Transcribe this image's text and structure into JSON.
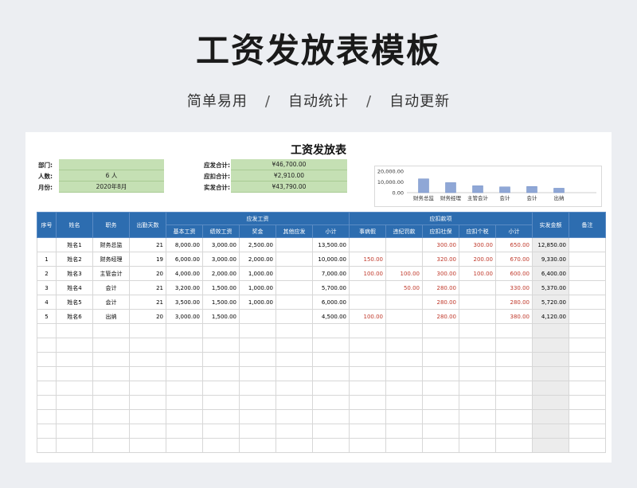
{
  "hero": {
    "title": "工资发放表模板",
    "subtitle_parts": [
      "简单易用",
      "/",
      "自动统计",
      "/",
      "自动更新"
    ]
  },
  "sheet": {
    "title": "工资发放表",
    "left_info": [
      {
        "label": "部门:",
        "value": ""
      },
      {
        "label": "人数:",
        "value": "6 人"
      },
      {
        "label": "月份:",
        "value": "2020年8月"
      }
    ],
    "totals_info": [
      {
        "label": "应发合计:",
        "value": "¥46,700.00"
      },
      {
        "label": "应扣合计:",
        "value": "¥2,910.00"
      },
      {
        "label": "实发合计:",
        "value": "¥43,790.00"
      }
    ]
  },
  "chart_data": {
    "type": "bar",
    "categories": [
      "财务总监",
      "财务经理",
      "主管会计",
      "会计",
      "会计",
      "出纳"
    ],
    "values": [
      12850,
      9330,
      6400,
      5370,
      5720,
      4120
    ],
    "tick_labels": [
      "20,000.00",
      "10,000.00",
      "0.00"
    ],
    "ylim": [
      0,
      20000
    ],
    "bar_color": "#8fa7d6",
    "grid": false
  },
  "table": {
    "header_top": {
      "seq": "序号",
      "name": "姓名",
      "position": "职务",
      "days": "出勤天数",
      "payable_group": "应发工资",
      "deduct_group": "应扣款项",
      "net": "实发金额",
      "note": "备注"
    },
    "header_sub": {
      "base": "基本工资",
      "perf": "绩效工资",
      "bonus": "奖金",
      "other": "其他应发",
      "sub1": "小计",
      "sick": "事病假",
      "fine": "违纪罚款",
      "social": "应扣社保",
      "tax": "应扣个税",
      "sub2": "小计"
    },
    "rows": [
      {
        "seq": "",
        "name": "姓名1",
        "position": "财务总监",
        "days": "21",
        "base": "8,000.00",
        "perf": "3,000.00",
        "bonus": "2,500.00",
        "other": "",
        "sub1": "13,500.00",
        "sick": "",
        "fine": "",
        "social": "300.00",
        "tax": "300.00",
        "sub2": "650.00",
        "net": "12,850.00",
        "note": ""
      },
      {
        "seq": "1",
        "name": "姓名2",
        "position": "财务经理",
        "days": "19",
        "base": "6,000.00",
        "perf": "3,000.00",
        "bonus": "2,000.00",
        "other": "",
        "sub1": "10,000.00",
        "sick": "150.00",
        "fine": "",
        "social": "320.00",
        "tax": "200.00",
        "sub2": "670.00",
        "net": "9,330.00",
        "note": ""
      },
      {
        "seq": "2",
        "name": "姓名3",
        "position": "主管会计",
        "days": "20",
        "base": "4,000.00",
        "perf": "2,000.00",
        "bonus": "1,000.00",
        "other": "",
        "sub1": "7,000.00",
        "sick": "100.00",
        "fine": "100.00",
        "social": "300.00",
        "tax": "100.00",
        "sub2": "600.00",
        "net": "6,400.00",
        "note": ""
      },
      {
        "seq": "3",
        "name": "姓名4",
        "position": "会计",
        "days": "21",
        "base": "3,200.00",
        "perf": "1,500.00",
        "bonus": "1,000.00",
        "other": "",
        "sub1": "5,700.00",
        "sick": "",
        "fine": "50.00",
        "social": "280.00",
        "tax": "",
        "sub2": "330.00",
        "net": "5,370.00",
        "note": ""
      },
      {
        "seq": "4",
        "name": "姓名5",
        "position": "会计",
        "days": "21",
        "base": "3,500.00",
        "perf": "1,500.00",
        "bonus": "1,000.00",
        "other": "",
        "sub1": "6,000.00",
        "sick": "",
        "fine": "",
        "social": "280.00",
        "tax": "",
        "sub2": "280.00",
        "net": "5,720.00",
        "note": ""
      },
      {
        "seq": "5",
        "name": "姓名6",
        "position": "出纳",
        "days": "20",
        "base": "3,000.00",
        "perf": "1,500.00",
        "bonus": "",
        "other": "",
        "sub1": "4,500.00",
        "sick": "100.00",
        "fine": "",
        "social": "280.00",
        "tax": "",
        "sub2": "380.00",
        "net": "4,120.00",
        "note": ""
      }
    ],
    "empty_rows": 9
  }
}
